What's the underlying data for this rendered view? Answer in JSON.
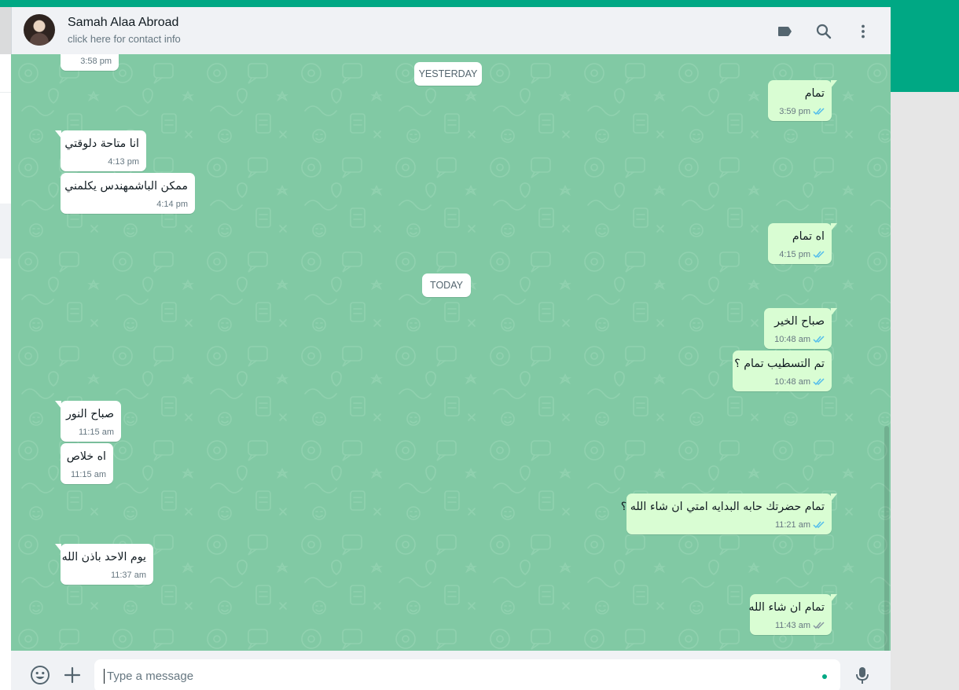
{
  "contact": {
    "name": "Samah Alaa Abroad",
    "subtitle": "click here for contact info"
  },
  "header_icons": [
    "label-icon",
    "search-icon",
    "menu-icon"
  ],
  "date_chips": {
    "yesterday": "YESTERDAY",
    "today": "TODAY"
  },
  "messages": [
    {
      "dir": "in",
      "text": "",
      "time": "3:58 pm"
    },
    {
      "dir": "out",
      "text": "تمام",
      "time": "3:59 pm",
      "status": "read"
    },
    {
      "dir": "in",
      "text": "انا متاحة دلوقتي",
      "time": "4:13 pm"
    },
    {
      "dir": "in",
      "text": "ممكن الباشمهندس يكلمني",
      "time": "4:14 pm"
    },
    {
      "dir": "out",
      "text": "اه تمام",
      "time": "4:15 pm",
      "status": "read"
    },
    {
      "dir": "out",
      "text": "صباح الخير",
      "time": "10:48 am",
      "status": "read"
    },
    {
      "dir": "out",
      "text": "تم التسطيب تمام ؟",
      "time": "10:48 am",
      "status": "read"
    },
    {
      "dir": "in",
      "text": "صباح النور",
      "time": "11:15 am"
    },
    {
      "dir": "in",
      "text": "اه خلاص",
      "time": "11:15 am"
    },
    {
      "dir": "out",
      "text": "تمام حضرتك حابه البدايه امتي ان شاء الله ؟",
      "time": "11:21 am",
      "status": "read"
    },
    {
      "dir": "in",
      "text": "يوم الاحد باذن الله",
      "time": "11:37 am"
    },
    {
      "dir": "out",
      "text": "تمام ان شاء الله",
      "time": "11:43 am",
      "status": "delivered"
    }
  ],
  "composer": {
    "placeholder": "Type a message"
  },
  "colors": {
    "brand": "#00a884",
    "chat_bg": "#81c9a4",
    "outgoing_bubble": "#d9fdd3",
    "incoming_bubble": "#ffffff",
    "read_tick": "#53bdeb",
    "delivered_tick": "#8696a0"
  }
}
